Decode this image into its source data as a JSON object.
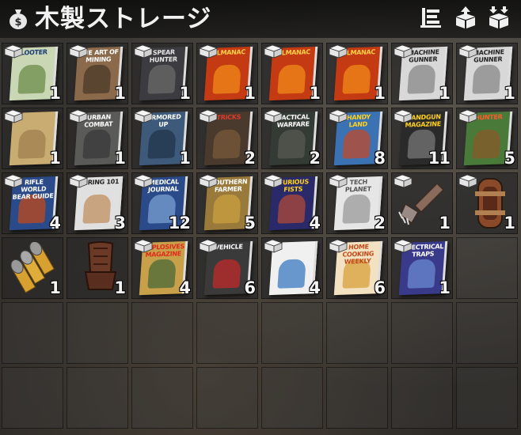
{
  "window": {
    "title": "木製ストレージ",
    "title_icon": "money-bag-icon",
    "buttons": [
      {
        "name": "sort-button",
        "icon": "sort-icon"
      },
      {
        "name": "take-all-button",
        "icon": "box-up-icon"
      },
      {
        "name": "place-all-button",
        "icon": "box-down-icon"
      }
    ]
  },
  "colors": {
    "title_text": "#f2f2f2",
    "slot_bg": "#282828",
    "quantity_text": "#f4f4f4"
  },
  "grid": {
    "columns": 8,
    "rows": 6
  },
  "slots": [
    {
      "item": "book",
      "cover_title": "LOOTER",
      "qty": "1",
      "cover": "#c9d7b4",
      "title_color": "#1a3b7a",
      "art": "#6c8c4a"
    },
    {
      "item": "book",
      "cover_title": "THE ART OF MINING",
      "qty": "1",
      "cover": "#8a6a4a",
      "title_color": "#ffffff",
      "art": "#4a3a2a"
    },
    {
      "item": "book",
      "cover_title": "SPEAR HUNTER",
      "qty": "1",
      "cover": "#3c3c40",
      "title_color": "#e6e6e6",
      "art": "#6a6a6a"
    },
    {
      "item": "book",
      "cover_title": "ALMANAC",
      "qty": "1",
      "cover": "#c43a12",
      "title_color": "#ffd24a",
      "art": "#f08a1a"
    },
    {
      "item": "book",
      "cover_title": "ALMANAC",
      "qty": "1",
      "cover": "#c43a12",
      "title_color": "#ffd24a",
      "art": "#f08a1a"
    },
    {
      "item": "book",
      "cover_title": "ALMANAC",
      "qty": "1",
      "cover": "#c43a12",
      "title_color": "#ffd24a",
      "art": "#f08a1a"
    },
    {
      "item": "book",
      "cover_title": "MACHINE GUNNER",
      "qty": "1",
      "cover": "#d8d8d8",
      "title_color": "#222222",
      "art": "#888888"
    },
    {
      "item": "book",
      "cover_title": "MACHINE GUNNER",
      "qty": "1",
      "cover": "#d8d8d8",
      "title_color": "#222222",
      "art": "#888888"
    },
    {
      "item": "book",
      "cover_title": "",
      "qty": "1",
      "cover": "#c8ac72",
      "title_color": "#5a4020",
      "art": "#a08050"
    },
    {
      "item": "book",
      "cover_title": "URBAN COMBAT",
      "qty": "1",
      "cover": "#5a5a58",
      "title_color": "#ffffff",
      "art": "#3a3a3a"
    },
    {
      "item": "book",
      "cover_title": "ARMORED UP",
      "qty": "1",
      "cover": "#3e5a7a",
      "title_color": "#ffffff",
      "art": "#22364c"
    },
    {
      "item": "book",
      "cover_title": "TRICKS",
      "qty": "2",
      "cover": "#4a3a2e",
      "title_color": "#e03a2a",
      "art": "#7a5a3a"
    },
    {
      "item": "book",
      "cover_title": "TACTICAL WARFARE",
      "qty": "2",
      "cover": "#343a34",
      "title_color": "#ffffff",
      "art": "#555a50"
    },
    {
      "item": "book",
      "cover_title": "HANDY LAND",
      "qty": "8",
      "cover": "#3a72b4",
      "title_color": "#ffd21a",
      "art": "#c04a2a"
    },
    {
      "item": "book",
      "cover_title": "HANDGUN MAGAZINE",
      "qty": "11",
      "cover": "#2a2a2a",
      "title_color": "#ffd21a",
      "art": "#777777"
    },
    {
      "item": "book",
      "cover_title": "HUNTER",
      "qty": "5",
      "cover": "#4a7a3a",
      "title_color": "#ff5a2a",
      "art": "#8a5a2a"
    },
    {
      "item": "book",
      "cover_title": "RIFLE WORLD BEAR GUIDE",
      "qty": "4",
      "cover": "#2a4a8a",
      "title_color": "#ffffff",
      "art": "#c04a1a"
    },
    {
      "item": "book",
      "cover_title": "WIRING 101",
      "qty": "3",
      "cover": "#e0e0e0",
      "title_color": "#222222",
      "art": "#c09060"
    },
    {
      "item": "book",
      "cover_title": "MEDICAL JOURNAL",
      "qty": "12",
      "cover": "#2a4a8a",
      "title_color": "#ffffff",
      "art": "#7aa0d0"
    },
    {
      "item": "book",
      "cover_title": "SOUTHERN FARMER",
      "qty": "5",
      "cover": "#9a7a3a",
      "title_color": "#ffffff",
      "art": "#c8a040"
    },
    {
      "item": "book",
      "cover_title": "FURIOUS FISTS",
      "qty": "4",
      "cover": "#2a2a6a",
      "title_color": "#ffd21a",
      "art": "#b04a3a"
    },
    {
      "item": "book",
      "cover_title": "TECH PLANET",
      "qty": "2",
      "cover": "#e6e6e6",
      "title_color": "#555555",
      "art": "#9a9a9a"
    },
    {
      "item": "tool",
      "shape": "wrench",
      "qty": "1"
    },
    {
      "item": "tool",
      "shape": "armguard",
      "qty": "1"
    },
    {
      "item": "ammo",
      "shape": "bullets",
      "qty": "1"
    },
    {
      "item": "seat",
      "shape": "seat",
      "qty": "1"
    },
    {
      "item": "book",
      "cover_title": "EXPLOSIVES MAGAZINE",
      "qty": "4",
      "cover": "#c8a04a",
      "title_color": "#e02a1a",
      "art": "#4a6a3a"
    },
    {
      "item": "book",
      "cover_title": "VEHICLE",
      "qty": "6",
      "cover": "#3a3a3a",
      "title_color": "#ffffff",
      "art": "#c02a2a"
    },
    {
      "item": "book",
      "cover_title": "",
      "qty": "4",
      "cover": "#f0f0f0",
      "title_color": "#222222",
      "art": "#3a7ac0"
    },
    {
      "item": "book",
      "cover_title": "HOME COOKING WEEKLY",
      "qty": "6",
      "cover": "#f2e2c2",
      "title_color": "#c04a1a",
      "art": "#d8a03a"
    },
    {
      "item": "book",
      "cover_title": "ELECTRICAL TRAPS",
      "qty": "1",
      "cover": "#3a3a8a",
      "title_color": "#ffffff",
      "art": "#6a8ad0"
    },
    {
      "item": "empty"
    },
    {
      "item": "empty"
    },
    {
      "item": "empty"
    },
    {
      "item": "empty"
    },
    {
      "item": "empty"
    },
    {
      "item": "empty"
    },
    {
      "item": "empty"
    },
    {
      "item": "empty"
    },
    {
      "item": "empty"
    },
    {
      "item": "empty"
    },
    {
      "item": "empty"
    },
    {
      "item": "empty"
    },
    {
      "item": "empty"
    },
    {
      "item": "empty"
    },
    {
      "item": "empty"
    },
    {
      "item": "empty"
    },
    {
      "item": "empty"
    }
  ]
}
